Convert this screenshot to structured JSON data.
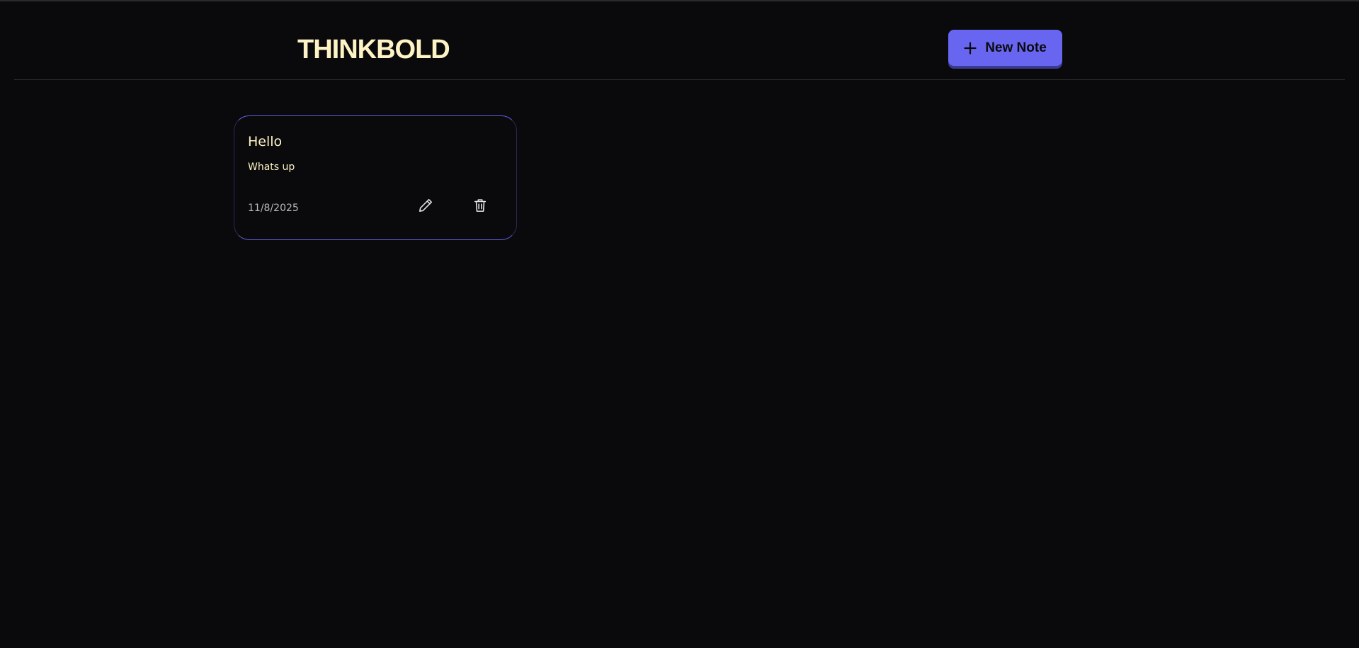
{
  "app": {
    "brand": "THINKBOLD"
  },
  "header": {
    "new_note_label": "New Note",
    "new_note_icon": "plus-icon"
  },
  "notes": [
    {
      "title": "Hello",
      "content": "Whats up",
      "date": "11/8/2025",
      "edit_icon": "pencil-icon",
      "delete_icon": "trash-icon"
    }
  ],
  "colors": {
    "background": "#0a0a0c",
    "accent": "#6866f1",
    "brand_text": "#fdf3c4",
    "muted_text": "#b9b9bd"
  }
}
